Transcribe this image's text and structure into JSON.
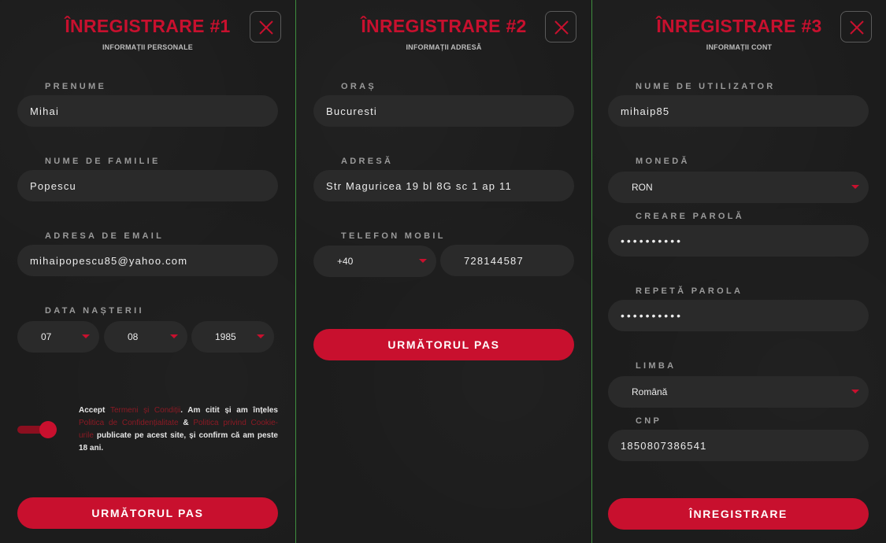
{
  "step1": {
    "title": "ÎNREGISTRARE #1",
    "subtitle": "INFORMAȚII PERSONALE",
    "first_name_label": "PRENUME",
    "first_name_value": "Mihai",
    "last_name_label": "NUME DE FAMILIE",
    "last_name_value": "Popescu",
    "email_label": "ADRESA DE EMAIL",
    "email_value": "mihaipopescu85@yahoo.com",
    "birthdate_label": "DATA NAȘTERII",
    "birth_month": "07",
    "birth_day": "08",
    "birth_year": "1985",
    "terms": {
      "t1": "Accept ",
      "link1": "Termeni și Condiții",
      "t2": ". Am citit și am înțeles ",
      "link2": "Politica de Confidențialitate",
      "t3": " & ",
      "link3": "Politica privind Cookie-urile",
      "t4": " publicate pe acest site, și confirm că am peste 18 ani."
    },
    "terms_accepted": true,
    "next_label": "URMĂTORUL PAS"
  },
  "step2": {
    "title": "ÎNREGISTRARE #2",
    "subtitle": "INFORMAȚII ADRESĂ",
    "city_label": "ORAȘ",
    "city_value": "Bucuresti",
    "address_label": "ADRESĂ",
    "address_value": "Str Maguricea 19 bl 8G sc 1 ap 11",
    "phone_label": "TELEFON MOBIL",
    "phone_prefix": "+40",
    "phone_value": "728144587",
    "next_label": "URMĂTORUL PAS"
  },
  "step3": {
    "title": "ÎNREGISTRARE #3",
    "subtitle": "INFORMAȚII CONT",
    "username_label": "NUME DE UTILIZATOR",
    "username_value": "mihaip85",
    "currency_label": "MONEDĂ",
    "currency_value": "RON",
    "password_label": "CREARE PAROLĂ",
    "password_value": "••••••••••",
    "repeat_password_label": "REPETĂ PAROLA",
    "repeat_password_value": "••••••••••",
    "language_label": "LIMBA",
    "language_value": "Română",
    "cnp_label": "CNP",
    "cnp_value": "1850807386541",
    "submit_label": "ÎNREGISTRARE"
  },
  "colors": {
    "accent": "#c8102e",
    "background": "#1c1c1c",
    "field": "#2a2a2a",
    "divider": "#3f8f3f"
  },
  "icons": {
    "close": "close-icon",
    "dropdown": "dropdown-caret-icon"
  }
}
